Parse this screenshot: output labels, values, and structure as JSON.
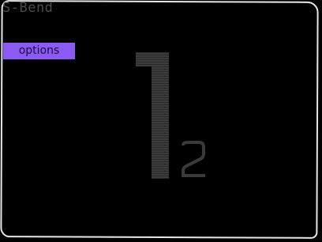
{
  "app": {
    "title": "S-Bend"
  },
  "menu": {
    "options_label": "options"
  },
  "level": {
    "main": "1",
    "sub": "2"
  },
  "colors": {
    "background": "#000000",
    "frame": "#e6e6e6",
    "title_text": "#4a4a4a",
    "accent": "#8d59f5",
    "numeral": "#3a3a3a"
  }
}
